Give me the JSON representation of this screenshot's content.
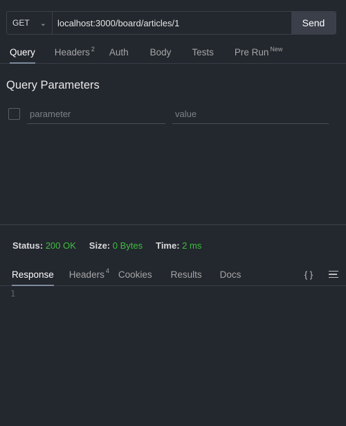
{
  "request": {
    "method": "GET",
    "url": "localhost:3000/board/articles/1",
    "send_label": "Send"
  },
  "request_tabs": [
    {
      "label": "Query",
      "active": true
    },
    {
      "label": "Headers",
      "badge": "2"
    },
    {
      "label": "Auth"
    },
    {
      "label": "Body"
    },
    {
      "label": "Tests"
    },
    {
      "label": "Pre Run",
      "badge": "New"
    }
  ],
  "query": {
    "title": "Query Parameters",
    "param_placeholder": "parameter",
    "value_placeholder": "value"
  },
  "status": {
    "status_label": "Status:",
    "status_value": "200 OK",
    "size_label": "Size:",
    "size_value": "0 Bytes",
    "time_label": "Time:",
    "time_value": "2 ms",
    "ok_color": "#3fbf3f"
  },
  "response_tabs": [
    {
      "label": "Response",
      "active": true
    },
    {
      "label": "Headers",
      "badge": "4"
    },
    {
      "label": "Cookies"
    },
    {
      "label": "Results"
    },
    {
      "label": "Docs"
    }
  ],
  "response_icons": {
    "json_icon": "{ }",
    "menu_icon": "menu-icon"
  },
  "editor": {
    "line_numbers": [
      "1"
    ]
  }
}
